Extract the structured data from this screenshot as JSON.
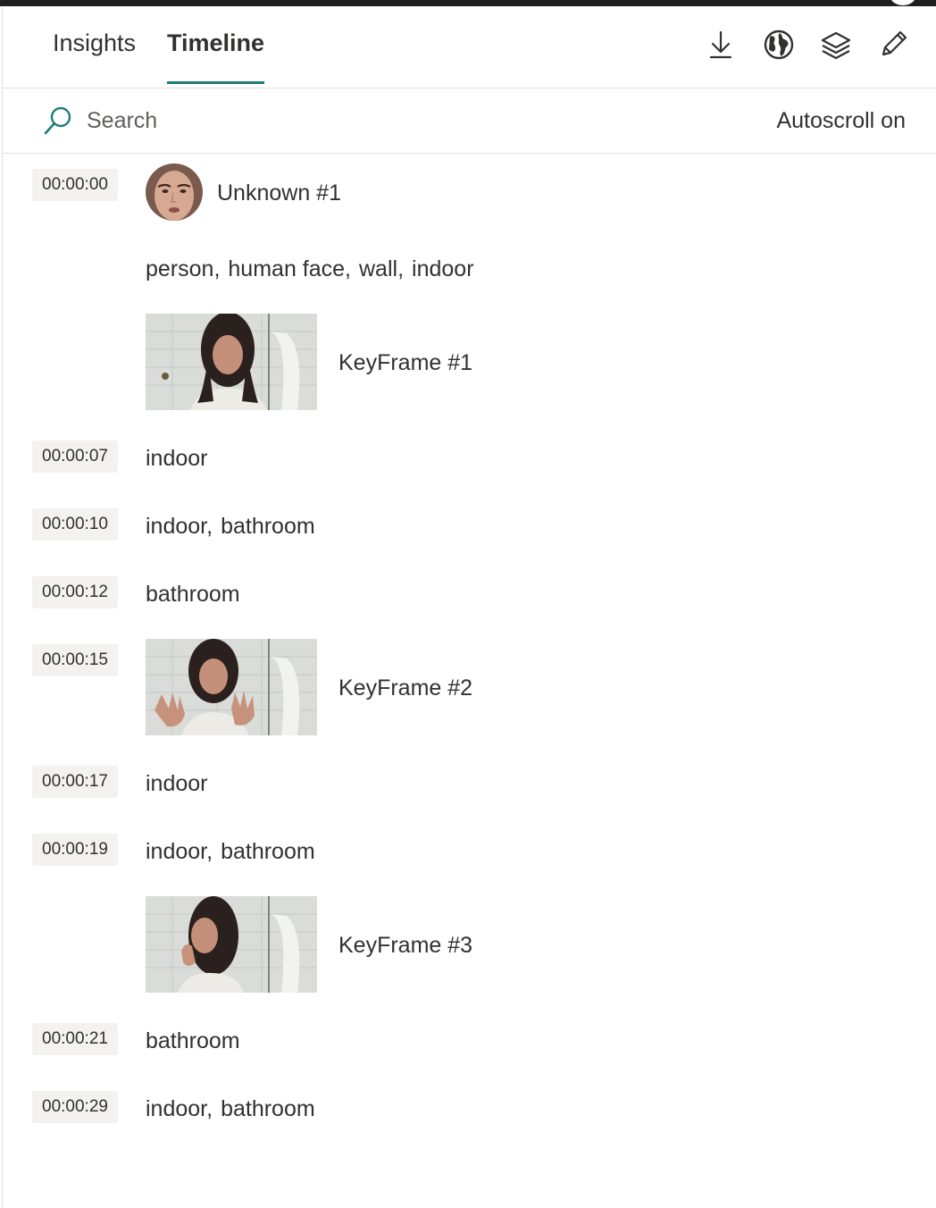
{
  "header": {
    "tabs": [
      {
        "label": "Insights",
        "active": false
      },
      {
        "label": "Timeline",
        "active": true
      }
    ],
    "actions": [
      {
        "icon": "download-icon"
      },
      {
        "icon": "globe-icon"
      },
      {
        "icon": "layers-icon"
      },
      {
        "icon": "edit-pencil-icon"
      }
    ],
    "accent_color": "#1e7d73"
  },
  "search": {
    "placeholder": "Search",
    "autoscroll_label": "Autoscroll on"
  },
  "timeline": {
    "entries": [
      {
        "time": "00:00:00"
      },
      {
        "time": "00:00:07"
      },
      {
        "time": "00:00:10"
      },
      {
        "time": "00:00:12"
      },
      {
        "time": "00:00:15"
      },
      {
        "time": "00:00:17"
      },
      {
        "time": "00:00:19"
      },
      {
        "time": "00:00:21"
      },
      {
        "time": "00:00:29"
      }
    ],
    "face": {
      "label": "Unknown #1"
    },
    "tags": {
      "t0": [
        "person",
        "human face",
        "wall",
        "indoor"
      ],
      "t7": [
        "indoor"
      ],
      "t10": [
        "indoor",
        "bathroom"
      ],
      "t12": [
        "bathroom"
      ],
      "t17": [
        "indoor"
      ],
      "t19": [
        "indoor",
        "bathroom"
      ],
      "t21": [
        "bathroom"
      ],
      "t29": [
        "indoor",
        "bathroom"
      ]
    },
    "keyframes": [
      {
        "label": "KeyFrame #1"
      },
      {
        "label": "KeyFrame #2"
      },
      {
        "label": "KeyFrame #3"
      }
    ]
  }
}
